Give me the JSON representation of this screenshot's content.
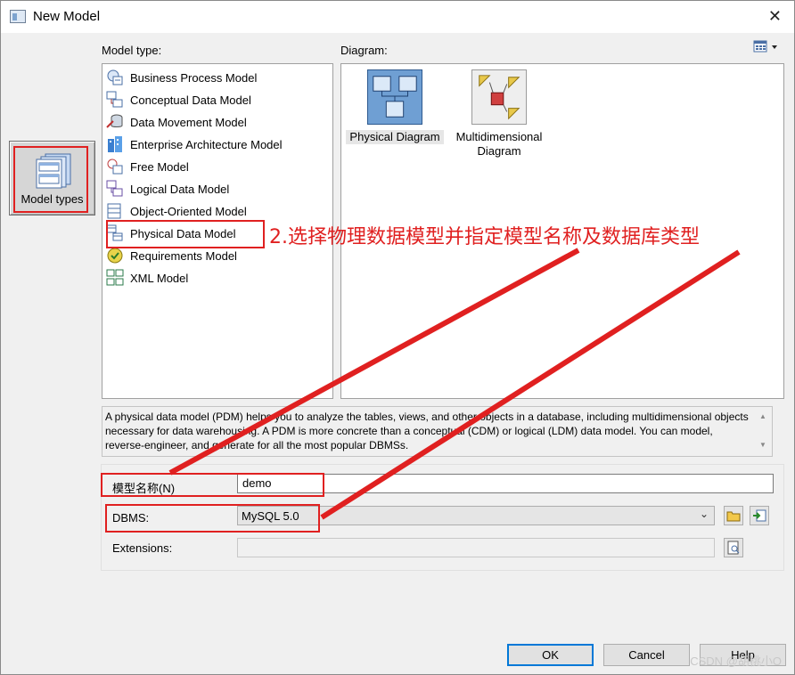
{
  "window": {
    "title": "New Model",
    "close_glyph": "✕"
  },
  "labels": {
    "model_type": "Model type:",
    "diagram": "Diagram:"
  },
  "sidebar": {
    "model_types_label": "Model types"
  },
  "model_types": [
    {
      "label": "Business Process Model",
      "icon": "bpm-icon"
    },
    {
      "label": "Conceptual Data Model",
      "icon": "cdm-icon"
    },
    {
      "label": "Data Movement Model",
      "icon": "dmm-icon"
    },
    {
      "label": "Enterprise Architecture Model",
      "icon": "eam-icon"
    },
    {
      "label": "Free Model",
      "icon": "free-model-icon"
    },
    {
      "label": "Logical Data Model",
      "icon": "ldm-icon"
    },
    {
      "label": "Object-Oriented Model",
      "icon": "oom-icon"
    },
    {
      "label": "Physical Data Model",
      "icon": "pdm-icon",
      "selected": true
    },
    {
      "label": "Requirements Model",
      "icon": "requirements-icon"
    },
    {
      "label": "XML Model",
      "icon": "xml-icon"
    }
  ],
  "diagrams": [
    {
      "label": "Physical Diagram",
      "selected": true
    },
    {
      "label": "Multidimensional Diagram"
    }
  ],
  "description": "A physical data model (PDM) helps you to analyze the tables, views, and other objects in a database, including multidimensional objects necessary for data warehousing. A PDM is more concrete than a conceptual (CDM) or logical (LDM) data model. You can model, reverse-engineer, and generate for all the most popular DBMSs.",
  "form": {
    "name_label": "模型名称(N)",
    "name_value": "demo",
    "dbms_label": "DBMS:",
    "dbms_value": "MySQL 5.0",
    "extensions_label": "Extensions:",
    "extensions_value": ""
  },
  "buttons": {
    "ok": "OK",
    "cancel": "Cancel",
    "help": "Help"
  },
  "annotation": {
    "text": "2.选择物理数据模型并指定模型名称及数据库类型",
    "color": "#e02020"
  },
  "watermark": "CSDN @胡桃小O",
  "colors": {
    "accent": "#0078d7",
    "selection": "#cce8ff",
    "annotation": "#e02020"
  }
}
